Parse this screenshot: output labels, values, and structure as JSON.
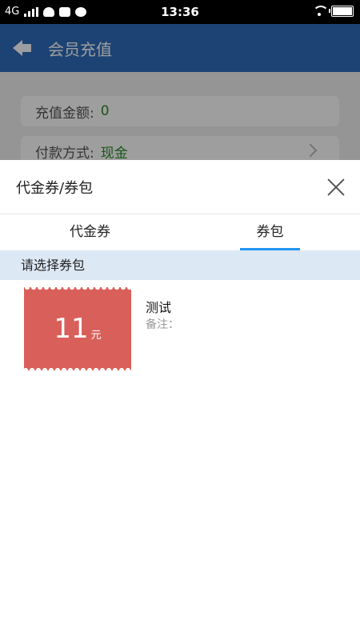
{
  "status_bar": {
    "network": "4G",
    "time": "13:36"
  },
  "background_page": {
    "title": "会员充值",
    "rows": [
      {
        "label": "充值金额:",
        "value": "0"
      },
      {
        "label": "付款方式:",
        "value": "现金"
      }
    ]
  },
  "sheet": {
    "title": "代金券/券包",
    "tabs": [
      {
        "label": "代金券",
        "active": false
      },
      {
        "label": "券包",
        "active": true
      }
    ],
    "section_label": "请选择券包",
    "vouchers": [
      {
        "amount": "11",
        "unit": "元",
        "name": "测试",
        "note": "备注："
      }
    ]
  },
  "colors": {
    "appbar": "#2f6cbc",
    "accent": "#2196f3",
    "ticket": "#d9605a",
    "section_bg": "#dde8f5"
  }
}
